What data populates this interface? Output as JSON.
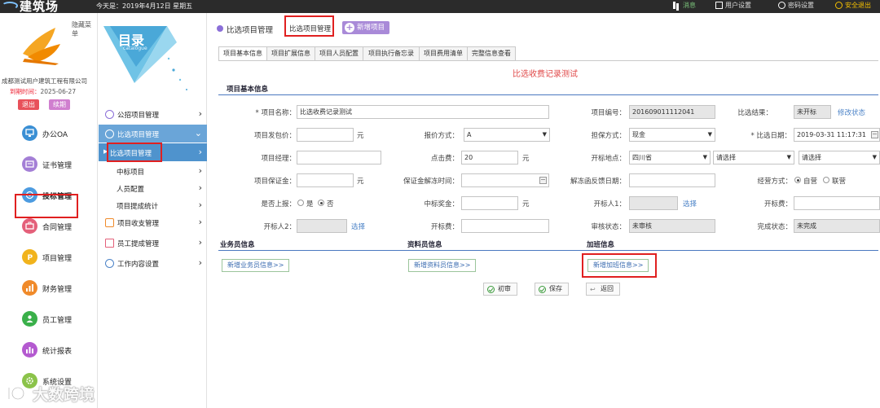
{
  "topbar": {
    "logo": "建筑场",
    "today": "今天是：2019年4月12日 星期五",
    "items": [
      "消息",
      "用户设置",
      "密码设置",
      "安全退出"
    ]
  },
  "left": {
    "hide_menu": "隐藏菜单",
    "company": "成都测试用户建筑工程有限公司",
    "expire_label": "到期时间：",
    "expire_value": "2025-06-27",
    "logout": "退出",
    "upgrade": "续期",
    "nav": [
      {
        "label": "办公OA",
        "color": "#3a8fd4"
      },
      {
        "label": "证书管理",
        "color": "#a47fd6"
      },
      {
        "label": "投标管理",
        "color": "#4c9be0"
      },
      {
        "label": "合同管理",
        "color": "#e4607a"
      },
      {
        "label": "项目管理",
        "color": "#f1b31c"
      },
      {
        "label": "财务管理",
        "color": "#f08a2a"
      },
      {
        "label": "员工管理",
        "color": "#3ab04a"
      },
      {
        "label": "统计报表",
        "color": "#b45ad0"
      },
      {
        "label": "系统设置",
        "color": "#8bc34a"
      }
    ]
  },
  "mid": {
    "catalog_big": "目录",
    "catalog_small": "catalogue",
    "menu": [
      {
        "label": "公招项目管理"
      },
      {
        "label": "比选项目管理"
      },
      {
        "label": "比选项目管理"
      },
      {
        "label": "中标项目"
      },
      {
        "label": "人员配置"
      },
      {
        "label": "项目提成统计"
      },
      {
        "label": "项目收支管理"
      },
      {
        "label": "员工提成管理"
      },
      {
        "label": "工作内容设置"
      }
    ]
  },
  "main": {
    "crumb1": "比选项目管理",
    "crumb2": "比选项目管理",
    "new_project": "新增项目",
    "tabs": [
      "项目基本信息",
      "项目扩展信息",
      "项目人员配置",
      "项目执行备忘录",
      "项目费用清单",
      "完整信息查看"
    ],
    "form_title": "比选收费记录测试",
    "section_basic": "项目基本信息",
    "fields": {
      "project_name_label": "* 项目名称：",
      "project_name": "比选收费记录测试",
      "project_no_label": "项目编号：",
      "project_no": "201609011112041",
      "result_label": "比选结果：",
      "result_value": "未开标",
      "modify_status": "修改状态",
      "price_label": "项目发包价：",
      "unit_yuan": "元",
      "quote_method_label": "报价方式：",
      "quote_method": "A",
      "guarantee_label": "担保方式：",
      "guarantee": "现金",
      "date_label": "* 比选日期：",
      "date_value": "2019-03-31 11:17:31",
      "manager_label": "项目经理：",
      "points_label": "点击费：",
      "points_value": "20",
      "location_label": "开标地点：",
      "province": "四川省",
      "please_select": "请选择",
      "deposit_label": "项目保证金：",
      "deposit_release_label": "保证金解冻时间：",
      "release_feedback_label": "解冻函反馈日期：",
      "operation_label": "经营方式：",
      "op_self": "自营",
      "op_joint": "联营",
      "report_label": "是否上报：",
      "yes": "是",
      "no": "否",
      "award_label": "中标奖金：",
      "opener1_label": "开标人1：",
      "select": "选择",
      "open_fee_label": "开标费：",
      "opener2_label": "开标人2：",
      "open_fee2_label": "开标费：",
      "audit_label": "审核状态：",
      "audit_value": "未审核",
      "complete_label": "完成状态：",
      "complete_value": "未完成"
    },
    "section_staff": "业务员信息",
    "section_data": "资料员信息",
    "section_overtime": "加班信息",
    "add_staff": "新增业务员信息>>",
    "add_data": "新增资料员信息>>",
    "add_overtime": "新增加班信息>>",
    "btn_review": "初审",
    "btn_save": "保存",
    "btn_back": "返回"
  },
  "watermark": "大数跨境"
}
